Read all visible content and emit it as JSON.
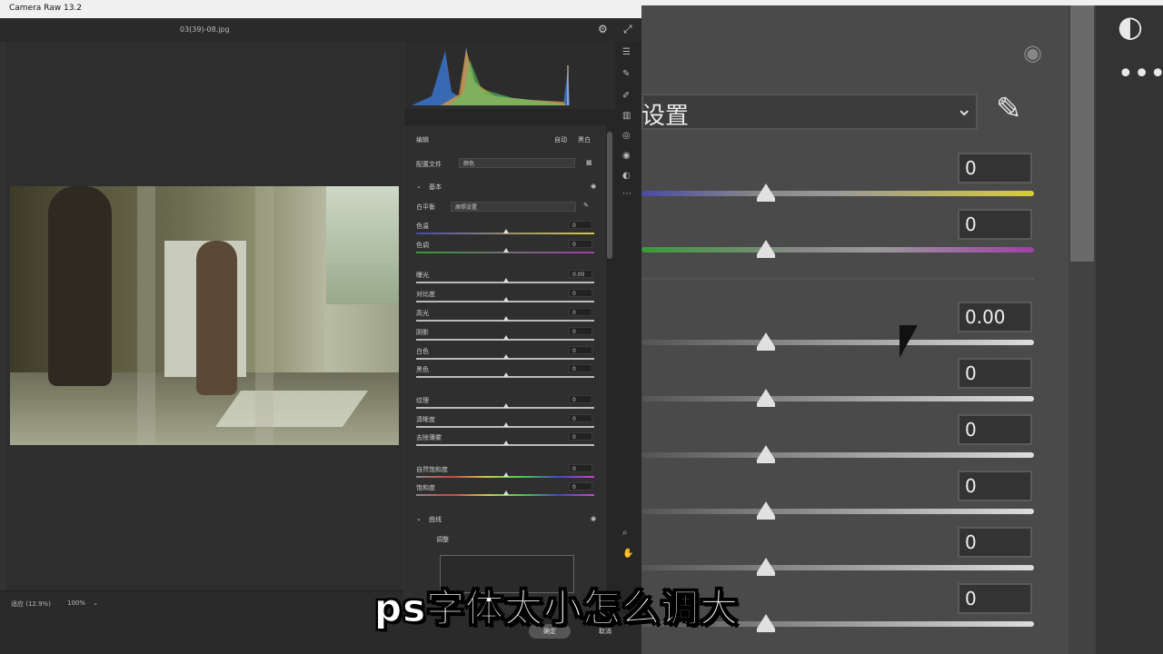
{
  "window": {
    "title": "Camera Raw 13.2",
    "filename": "03(39)-08.jpg"
  },
  "status": {
    "fit_label": "适应 (12.9%)",
    "zoom_value": "100%"
  },
  "dialog": {
    "ok_label": "确定",
    "cancel_label": "取消"
  },
  "panel": {
    "tab_edit": "编辑",
    "auto_label": "自动",
    "bw_label": "黑白",
    "profile_label": "配置文件",
    "profile_value": "颜色",
    "basic_section": "基本",
    "wb_label": "白平衡",
    "wb_value": "原照设置",
    "curves_section": "曲线",
    "curve_adjust_label": "调整",
    "sliders": [
      {
        "label": "色温",
        "value": "0"
      },
      {
        "label": "色调",
        "value": "0"
      },
      {
        "label": "曝光",
        "value": "0.00"
      },
      {
        "label": "对比度",
        "value": "0"
      },
      {
        "label": "高光",
        "value": "0"
      },
      {
        "label": "阴影",
        "value": "0"
      },
      {
        "label": "白色",
        "value": "0"
      },
      {
        "label": "黑色",
        "value": "0"
      },
      {
        "label": "纹理",
        "value": "0"
      },
      {
        "label": "清晰度",
        "value": "0"
      },
      {
        "label": "去除薄雾",
        "value": "0"
      },
      {
        "label": "自然饱和度",
        "value": "0"
      },
      {
        "label": "饱和度",
        "value": "0"
      }
    ]
  },
  "zoom": {
    "wb_fragment": "设置",
    "values": [
      "0",
      "0",
      "0.00",
      "0",
      "0",
      "0",
      "0",
      "0"
    ]
  },
  "caption": "ps字体太小怎么调大",
  "icons": [
    "settings-icon",
    "fullscreen-icon",
    "eye-icon",
    "eyedropper-icon",
    "chevron-down-icon",
    "more-icon",
    "zoom-icon",
    "hand-icon"
  ],
  "colors": {
    "temp_start": "#4a4aa8",
    "temp_end": "#d8cc3a",
    "tint_start": "#3a9a3a",
    "tint_end": "#a040a8"
  }
}
